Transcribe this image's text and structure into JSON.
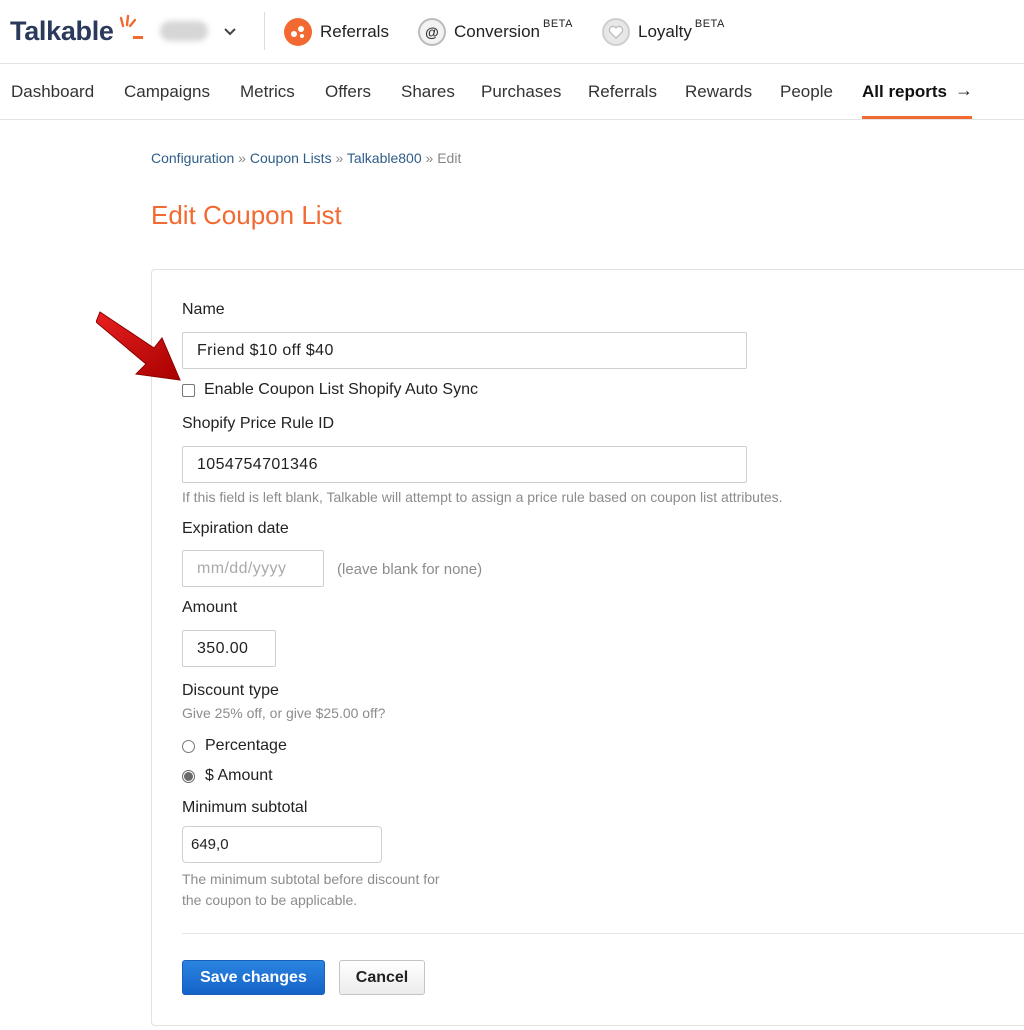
{
  "brand": {
    "name": "Talkable",
    "accent": "#f26a31",
    "link": "#2e5d8a",
    "primary_button": "#1a6dd0"
  },
  "header": {
    "account_chevron_icon": "chevron-down-icon",
    "products": [
      {
        "label": "Referrals",
        "badge": ""
      },
      {
        "label": "Conversion",
        "badge": "BETA"
      },
      {
        "label": "Loyalty",
        "badge": "BETA"
      }
    ]
  },
  "nav": {
    "items": [
      "Dashboard",
      "Campaigns",
      "Metrics",
      "Offers",
      "Shares",
      "Purchases",
      "Referrals",
      "Rewards",
      "People",
      "All reports"
    ],
    "active": "All reports",
    "arrow": "→"
  },
  "breadcrumb": {
    "items": [
      "Configuration",
      "Coupon Lists",
      "Talkable800"
    ],
    "separator": "»",
    "current": "Edit"
  },
  "page": {
    "title": "Edit Coupon List"
  },
  "form": {
    "name": {
      "label": "Name",
      "value": "Friend $10 off $40"
    },
    "auto_sync": {
      "label": "Enable Coupon List Shopify Auto Sync",
      "checked": false
    },
    "price_rule": {
      "label": "Shopify Price Rule ID",
      "value": "1054754701346",
      "help": "If this field is left blank, Talkable will attempt to assign a price rule based on coupon list attributes."
    },
    "expiration": {
      "label": "Expiration date",
      "placeholder": "mm/dd/yyyy",
      "hint": "(leave blank for none)"
    },
    "amount": {
      "label": "Amount",
      "value": "350.00"
    },
    "discount_type": {
      "label": "Discount type",
      "hint": "Give 25% off, or give $25.00 off?",
      "options": [
        "Percentage",
        "$ Amount"
      ],
      "selected": "$ Amount"
    },
    "min_subtotal": {
      "label": "Minimum subtotal",
      "value": "649,0",
      "help_line1": "The minimum subtotal before discount for",
      "help_line2": "the coupon to be applicable."
    },
    "actions": {
      "save": "Save changes",
      "cancel": "Cancel"
    }
  }
}
